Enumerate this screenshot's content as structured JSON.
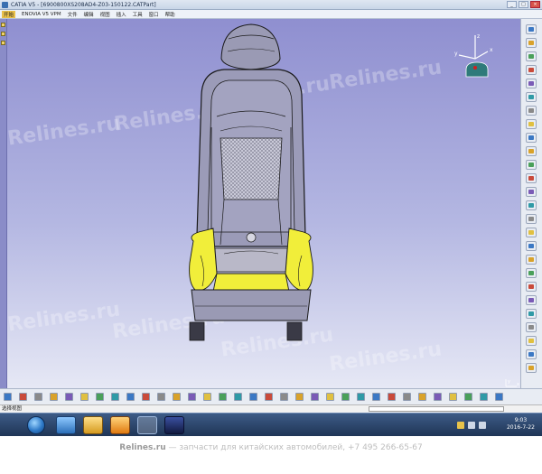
{
  "window": {
    "title": "CATIA V5 - [6900800XS208AD4-Z03-150122.CATPart]",
    "controls": [
      "_",
      "□",
      "×"
    ]
  },
  "menu": {
    "items": [
      "开始",
      "ENOVIA V5 VPM",
      "文件",
      "编辑",
      "视图",
      "插入",
      "工具",
      "窗口",
      "帮助"
    ]
  },
  "viewport": {
    "watermarks": [
      "Relines.ru",
      "Relines.ru",
      "Relines.ru",
      "Relines.ru",
      "Relines.ru",
      "Relines.ru",
      "Relines.ru",
      "Relines.ru"
    ],
    "compass_labels": {
      "x": "x",
      "y": "y",
      "z": "z"
    },
    "axis_labels": {
      "y": "y",
      "x": "x"
    },
    "colors": {
      "background_top": "#8f8fd0",
      "background_bottom": "#e6e8f5",
      "seat_highlight": "#f1ee3a",
      "seat_lines": "#1a1a1a"
    }
  },
  "toolbars": {
    "right": [
      "sketcher",
      "pad",
      "pocket",
      "shaft",
      "hole",
      "rib",
      "slot",
      "fillet",
      "chamfer",
      "draft",
      "shell",
      "thickness",
      "thread",
      "mirror",
      "pattern",
      "scale",
      "split",
      "thick-surface",
      "close-surface",
      "sew",
      "boolean-add",
      "boolean-remove",
      "intersect",
      "trim",
      "measure",
      "apply-material"
    ],
    "bottom": [
      "new",
      "open",
      "save",
      "print",
      "cut",
      "copy",
      "paste",
      "undo",
      "redo",
      "whats-this",
      "fly-mode",
      "fit-all",
      "pan",
      "rotate",
      "zoom-in",
      "zoom-out",
      "normal-view",
      "multi-view",
      "iso-view",
      "shading",
      "hide-show",
      "swap-space",
      "sketch",
      "update",
      "axis-system",
      "line",
      "plane",
      "point",
      "analysis",
      "constraint",
      "formula",
      "catalog",
      "sample"
    ]
  },
  "status": {
    "message": "选择视图",
    "command_value": ""
  },
  "taskbar": {
    "apps": [
      "ie-browser",
      "file-explorer",
      "media-player",
      "catia-v5",
      "image-viewer"
    ],
    "time": "9:03",
    "date": "2016-7-22"
  },
  "footer": {
    "brand": "Relines.ru",
    "text": " — запчасти для китайских автомобилей, +7 495 266-65-67"
  }
}
